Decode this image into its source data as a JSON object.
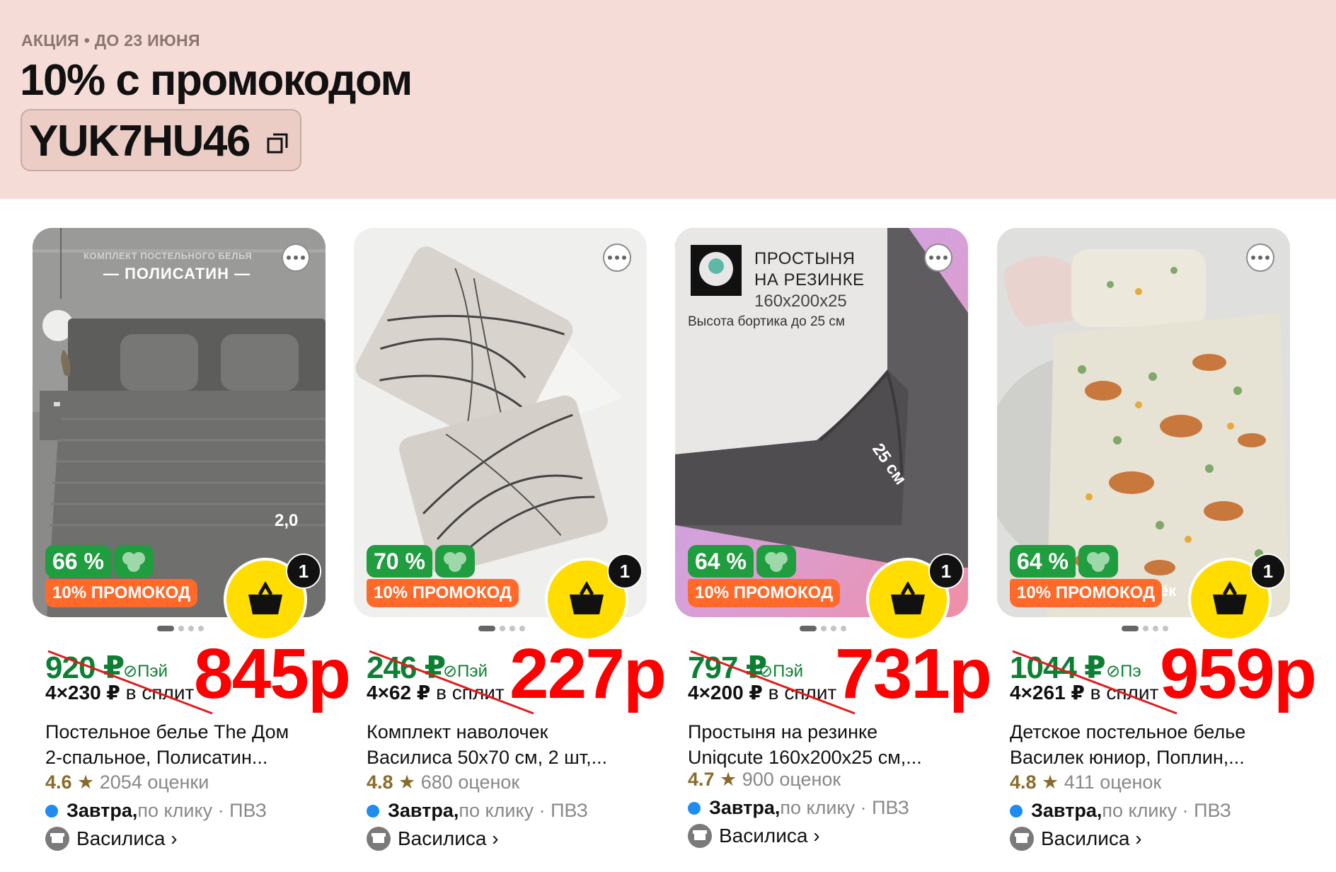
{
  "promo": {
    "eyebrow": "АКЦИЯ • ДО 23 ИЮНЯ",
    "title": "10% с промокодом",
    "code": "YUK7HU46"
  },
  "colors": {
    "banner_bg": "#f6dcd7",
    "discount_green": "#1f9d3f",
    "promo_orange": "#ff6a2b",
    "cart_yellow": "#ffdd00",
    "new_price_red": "#ff0000",
    "old_price_green": "#0c7f32"
  },
  "products": [
    {
      "image_text_1": "КОМПЛЕКТ ПОСТЕЛЬНОГО БЕЛЬЯ",
      "image_text_2": "— ПОЛИСАТИН —",
      "image_text_3": "2,0",
      "discount": "66 %",
      "promo_tag": "10% ПРОМОКОД",
      "cart_count": "1",
      "old_price": "920 ₽",
      "pay_label": "Пэй",
      "split": "4×230 ₽",
      "split_suffix": " в сплит",
      "new_price": "845р",
      "title_line1": "Постельное белье The Дом",
      "title_line2": "2-спальное, Полисатин...",
      "rating": "4.6",
      "reviews": "2054 оценки",
      "delivery_day": "Завтра,",
      "delivery_rest": " по клику · ПВЗ",
      "seller": "Василиса ›"
    },
    {
      "discount": "70 %",
      "promo_tag": "10% ПРОМОКОД",
      "cart_count": "1",
      "old_price": "246 ₽",
      "pay_label": "Пэй",
      "split": "4×62 ₽",
      "split_suffix": " в сплит",
      "new_price": "227р",
      "title_line1": "Комплект наволочек",
      "title_line2": "Василиса 50х70 см, 2 шт,...",
      "rating": "4.8",
      "reviews": "680 оценок",
      "delivery_day": "Завтра,",
      "delivery_rest": " по клику · ПВЗ",
      "seller": "Василиса ›"
    },
    {
      "image_text_1": "ПРОСТЫНЯ",
      "image_text_2": "НА РЕЗИНКЕ",
      "image_text_3": "160х200х25",
      "image_text_4": "Высота бортика до 25 см",
      "image_text_5": "25 см",
      "discount": "64 %",
      "promo_tag": "10% ПРОМОКОД",
      "cart_count": "1",
      "old_price": "797 ₽",
      "pay_label": "Пэй",
      "split": "4×200 ₽",
      "split_suffix": " в сплит",
      "new_price": "731р",
      "title_line1": "Простыня на резинке",
      "title_line2": "Uniqcute 160х200х25 см,...",
      "rating": "4.7",
      "reviews": "900 оценок",
      "delivery_day": "Завтра,",
      "delivery_rest": " по клику · ПВЗ",
      "seller": "Василиса ›"
    },
    {
      "image_text_1": "ёк",
      "discount": "64 %",
      "promo_tag": "10% ПРОМОКОД",
      "cart_count": "1",
      "old_price": "1044 ₽",
      "pay_label": "Пэ",
      "split": "4×261 ₽",
      "split_suffix": " в сплит",
      "new_price": "959р",
      "title_line1": "Детское постельное белье",
      "title_line2": "Василек юниор, Поплин,...",
      "rating": "4.8",
      "reviews": "411 оценок",
      "delivery_day": "Завтра,",
      "delivery_rest": " по клику · ПВЗ",
      "seller": "Василиса ›"
    }
  ]
}
